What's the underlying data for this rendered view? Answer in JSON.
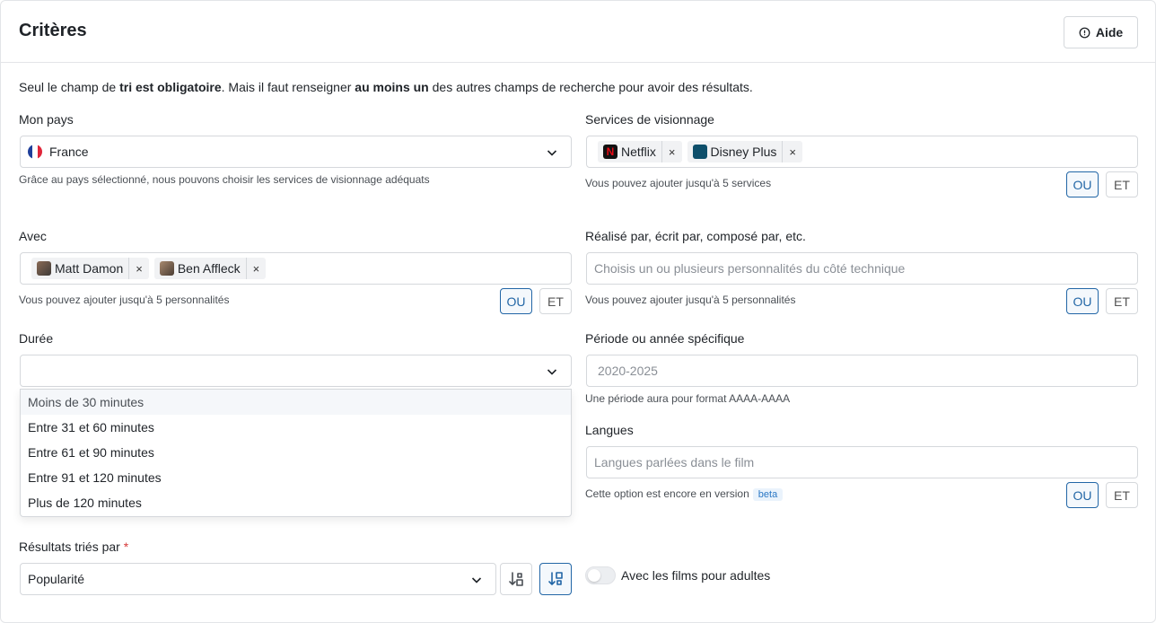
{
  "header": {
    "title": "Critères",
    "help_label": "Aide"
  },
  "intro": {
    "part1": "Seul le champ de ",
    "bold1": "tri est obligatoire",
    "part2": ". Mais il faut renseigner ",
    "bold2": "au moins un",
    "part3": " des autres champs de recherche pour avoir des résultats."
  },
  "country": {
    "label": "Mon pays",
    "value": "France",
    "hint": "Grâce au pays sélectionné, nous pouvons choisir les services de visionnage adéquats"
  },
  "services": {
    "label": "Services de visionnage",
    "tags": [
      {
        "label": "Netflix",
        "remove": "×"
      },
      {
        "label": "Disney Plus",
        "remove": "×"
      }
    ],
    "hint": "Vous pouvez ajouter jusqu'à 5 services",
    "or_label": "OU",
    "and_label": "ET"
  },
  "cast": {
    "label": "Avec",
    "tags": [
      {
        "label": "Matt Damon",
        "remove": "×"
      },
      {
        "label": "Ben Affleck",
        "remove": "×"
      }
    ],
    "hint": "Vous pouvez ajouter jusqu'à 5 personnalités",
    "or_label": "OU",
    "and_label": "ET"
  },
  "crew": {
    "label": "Réalisé par, écrit par, composé par, etc.",
    "placeholder": "Choisis un ou plusieurs personnalités du côté technique",
    "hint": "Vous pouvez ajouter jusqu'à 5 personnalités",
    "or_label": "OU",
    "and_label": "ET"
  },
  "duration": {
    "label": "Durée",
    "value": "",
    "options": [
      "Moins de 30 minutes",
      "Entre 31 et 60 minutes",
      "Entre 61 et 90 minutes",
      "Entre 91 et 120 minutes",
      "Plus de 120 minutes"
    ]
  },
  "period": {
    "label": "Période ou année spécifique",
    "placeholder": "2020-2025",
    "hint": "Une période aura pour format AAAA-AAAA"
  },
  "languages": {
    "label": "Langues",
    "placeholder": "Langues parlées dans le film",
    "hint": "Cette option est encore en version",
    "badge": "beta",
    "or_label": "OU",
    "and_label": "ET"
  },
  "sort": {
    "label": "Résultats triés par",
    "required_mark": "*",
    "value": "Popularité"
  },
  "adult": {
    "label": "Avec les films pour adultes",
    "enabled": false
  },
  "colors": {
    "accent": "#2266a6",
    "border": "#d5d8dc",
    "required": "#d63a3a",
    "netflix": "#e50914",
    "disney": "#0e4f6b"
  }
}
